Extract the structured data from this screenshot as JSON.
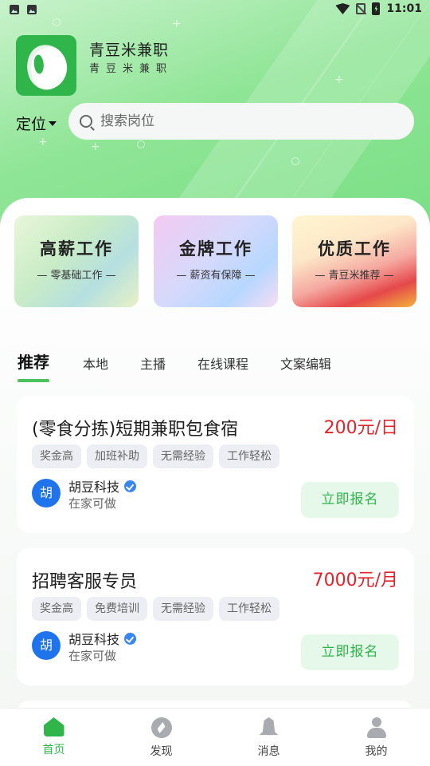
{
  "status_bar": {
    "time": "11:01"
  },
  "brand": {
    "title": "青豆米兼职",
    "subtitle": "青豆米兼职"
  },
  "location": {
    "label": "定位"
  },
  "search": {
    "placeholder": "搜索岗位"
  },
  "features": [
    {
      "title": "高薪工作",
      "subtitle": "— 零基础工作 —"
    },
    {
      "title": "金牌工作",
      "subtitle": "— 薪资有保障 —"
    },
    {
      "title": "优质工作",
      "subtitle": "— 青豆米推荐 —"
    }
  ],
  "tabs": [
    {
      "label": "推荐",
      "active": true
    },
    {
      "label": "本地"
    },
    {
      "label": "主播"
    },
    {
      "label": "在线课程"
    },
    {
      "label": "文案编辑"
    }
  ],
  "jobs": [
    {
      "title": "(零食分拣)短期兼职包食宿",
      "pay": "200元/日",
      "tags": [
        "奖金高",
        "加班补助",
        "无需经验",
        "工作轻松"
      ],
      "avatar_char": "胡",
      "company": "胡豆科技",
      "location": "在家可做",
      "apply_label": "立即报名"
    },
    {
      "title": "招聘客服专员",
      "pay": "7000元/月",
      "tags": [
        "奖金高",
        "免费培训",
        "无需经验",
        "工作轻松"
      ],
      "avatar_char": "胡",
      "company": "胡豆科技",
      "location": "在家可做",
      "apply_label": "立即报名"
    }
  ],
  "bottom_nav": [
    {
      "label": "首页",
      "icon": "home-icon",
      "active": true
    },
    {
      "label": "发现",
      "icon": "discover-icon"
    },
    {
      "label": "消息",
      "icon": "bell-icon"
    },
    {
      "label": "我的",
      "icon": "user-icon"
    }
  ],
  "colors": {
    "accent": "#2fb54a",
    "price": "#e0242b",
    "avatar": "#1f74ee"
  }
}
